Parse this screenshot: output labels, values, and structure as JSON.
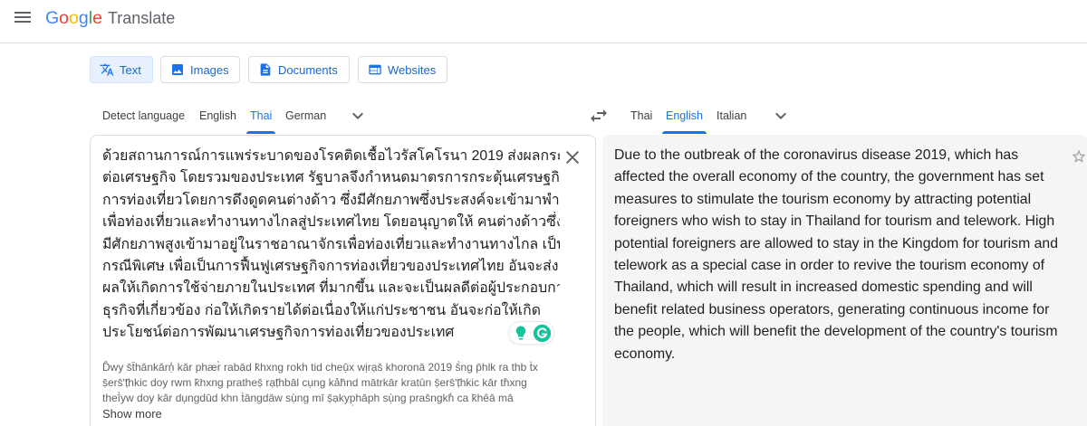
{
  "header": {
    "menu_icon": "menu-icon",
    "logo": {
      "word": "Google",
      "letter_colors": [
        "#4285f4",
        "#ea4335",
        "#fbbc05",
        "#4285f4",
        "#34a853",
        "#ea4335"
      ]
    },
    "product": "Translate"
  },
  "modes": [
    {
      "label": "Text",
      "icon": "translate-icon",
      "selected": true
    },
    {
      "label": "Images",
      "icon": "image-icon",
      "selected": false
    },
    {
      "label": "Documents",
      "icon": "document-icon",
      "selected": false
    },
    {
      "label": "Websites",
      "icon": "web-icon",
      "selected": false
    }
  ],
  "source_languages": {
    "options": [
      "Detect language",
      "English",
      "Thai",
      "German"
    ],
    "selected_index": 2,
    "more_icon": "chevron-down-icon"
  },
  "swap_icon": "swap-icon",
  "target_languages": {
    "options": [
      "Thai",
      "English",
      "Italian"
    ],
    "selected_index": 1,
    "more_icon": "chevron-down-icon"
  },
  "source": {
    "lines": [
      "ด้วยสถานการณ์การแพร่ระบาดของโรคติดเชื้อไวรัสโคโรนา 2019 ส่งผลกระทบ",
      "ต่อเศรษฐกิจ โดยรวมของประเทศ รัฐบาลจึงกำหนดมาตรการกระตุ้นเศรษฐกิจ",
      "การท่องเที่ยวโดยการดึงดูดคนต่างด้าว ซึ่งมีศักยภาพซึ่งประสงค์จะเข้ามาพำนัก",
      "เพื่อท่องเที่ยวและทำงานทางไกลสู่ประเทศไทย โดยอนุญาตให้ คนต่างด้าวซึ่ง",
      "มีศักยภาพสูงเข้ามาอยู่ในราชอาณาจักรเพื่อท่องเที่ยวและทำงานทางไกล เป็น",
      "กรณีพิเศษ เพื่อเป็นการฟื้นฟูเศรษฐกิจการท่องเที่ยวของประเทศไทย อันจะส่ง",
      "ผลให้เกิดการใช้จ่ายภายในประเทศ ที่มากขึ้น และจะเป็นผลดีต่อผู้ประกอบการ",
      "ธุรกิจที่เกี่ยวข้อง ก่อให้เกิดรายได้ต่อเนื่องให้แก่ประชาชน อันจะก่อให้เกิด",
      "ประโยชน์ต่อการพัฒนาเศรษฐกิจการท่องเที่ยวของประเทศ"
    ],
    "clear_icon": "close-icon",
    "grammarly": {
      "suggestion_icon": "lightbulb-icon",
      "logo_icon": "grammarly-icon"
    },
    "transliteration": [
      "D̂wy s̄t̄hānkārṇ̒ kār phær̀ rabād k̄hxng rokh tid cheụ̄x wịrạs̄ khoronā 2019 s̄̀ng p̄hlk ra thb t̀x",
      "ṣ̄ers̄ʹṭ̄hkic doy rwm k̄hxng pratheṣ̄ rạṭ̄hbāl cụng kảh̄nd mātrkār kratûn ṣ̄ers̄ʹṭ̄hkic kār th̀xng",
      "theī̀yw doy kār dụngdūd khn t̀āngdāw sụ̀ng mī ṣ̄ạkyp̣hāph sụ̀ng pras̄ngkh̒ ca k̄hêā mā"
    ],
    "show_more": "Show more"
  },
  "translation": {
    "lines": [
      "Due to the outbreak of the coronavirus disease 2019, which has",
      "affected the overall economy of the country, the government has set",
      "measures to stimulate the tourism economy by attracting potential",
      "foreigners who wish to stay in Thailand for tourism and telework. High",
      "potential foreigners are allowed to stay in the Kingdom for tourism and",
      "telework as a special case in order to revive the tourism economy of",
      "Thailand, which will result in increased domestic spending and will",
      "benefit related business operators, generating continuous income for",
      "the people, which will benefit the development of the country's tourism",
      "economy."
    ],
    "save_icon": "star-icon"
  },
  "colors": {
    "accent": "#1a73e8",
    "selected_tab_bg": "#e8f0fe",
    "text": "#202124",
    "muted_text": "#5f6368",
    "border": "#dadce0",
    "translation_bg": "#f5f5f5",
    "grammarly_green": "#15c39a"
  }
}
